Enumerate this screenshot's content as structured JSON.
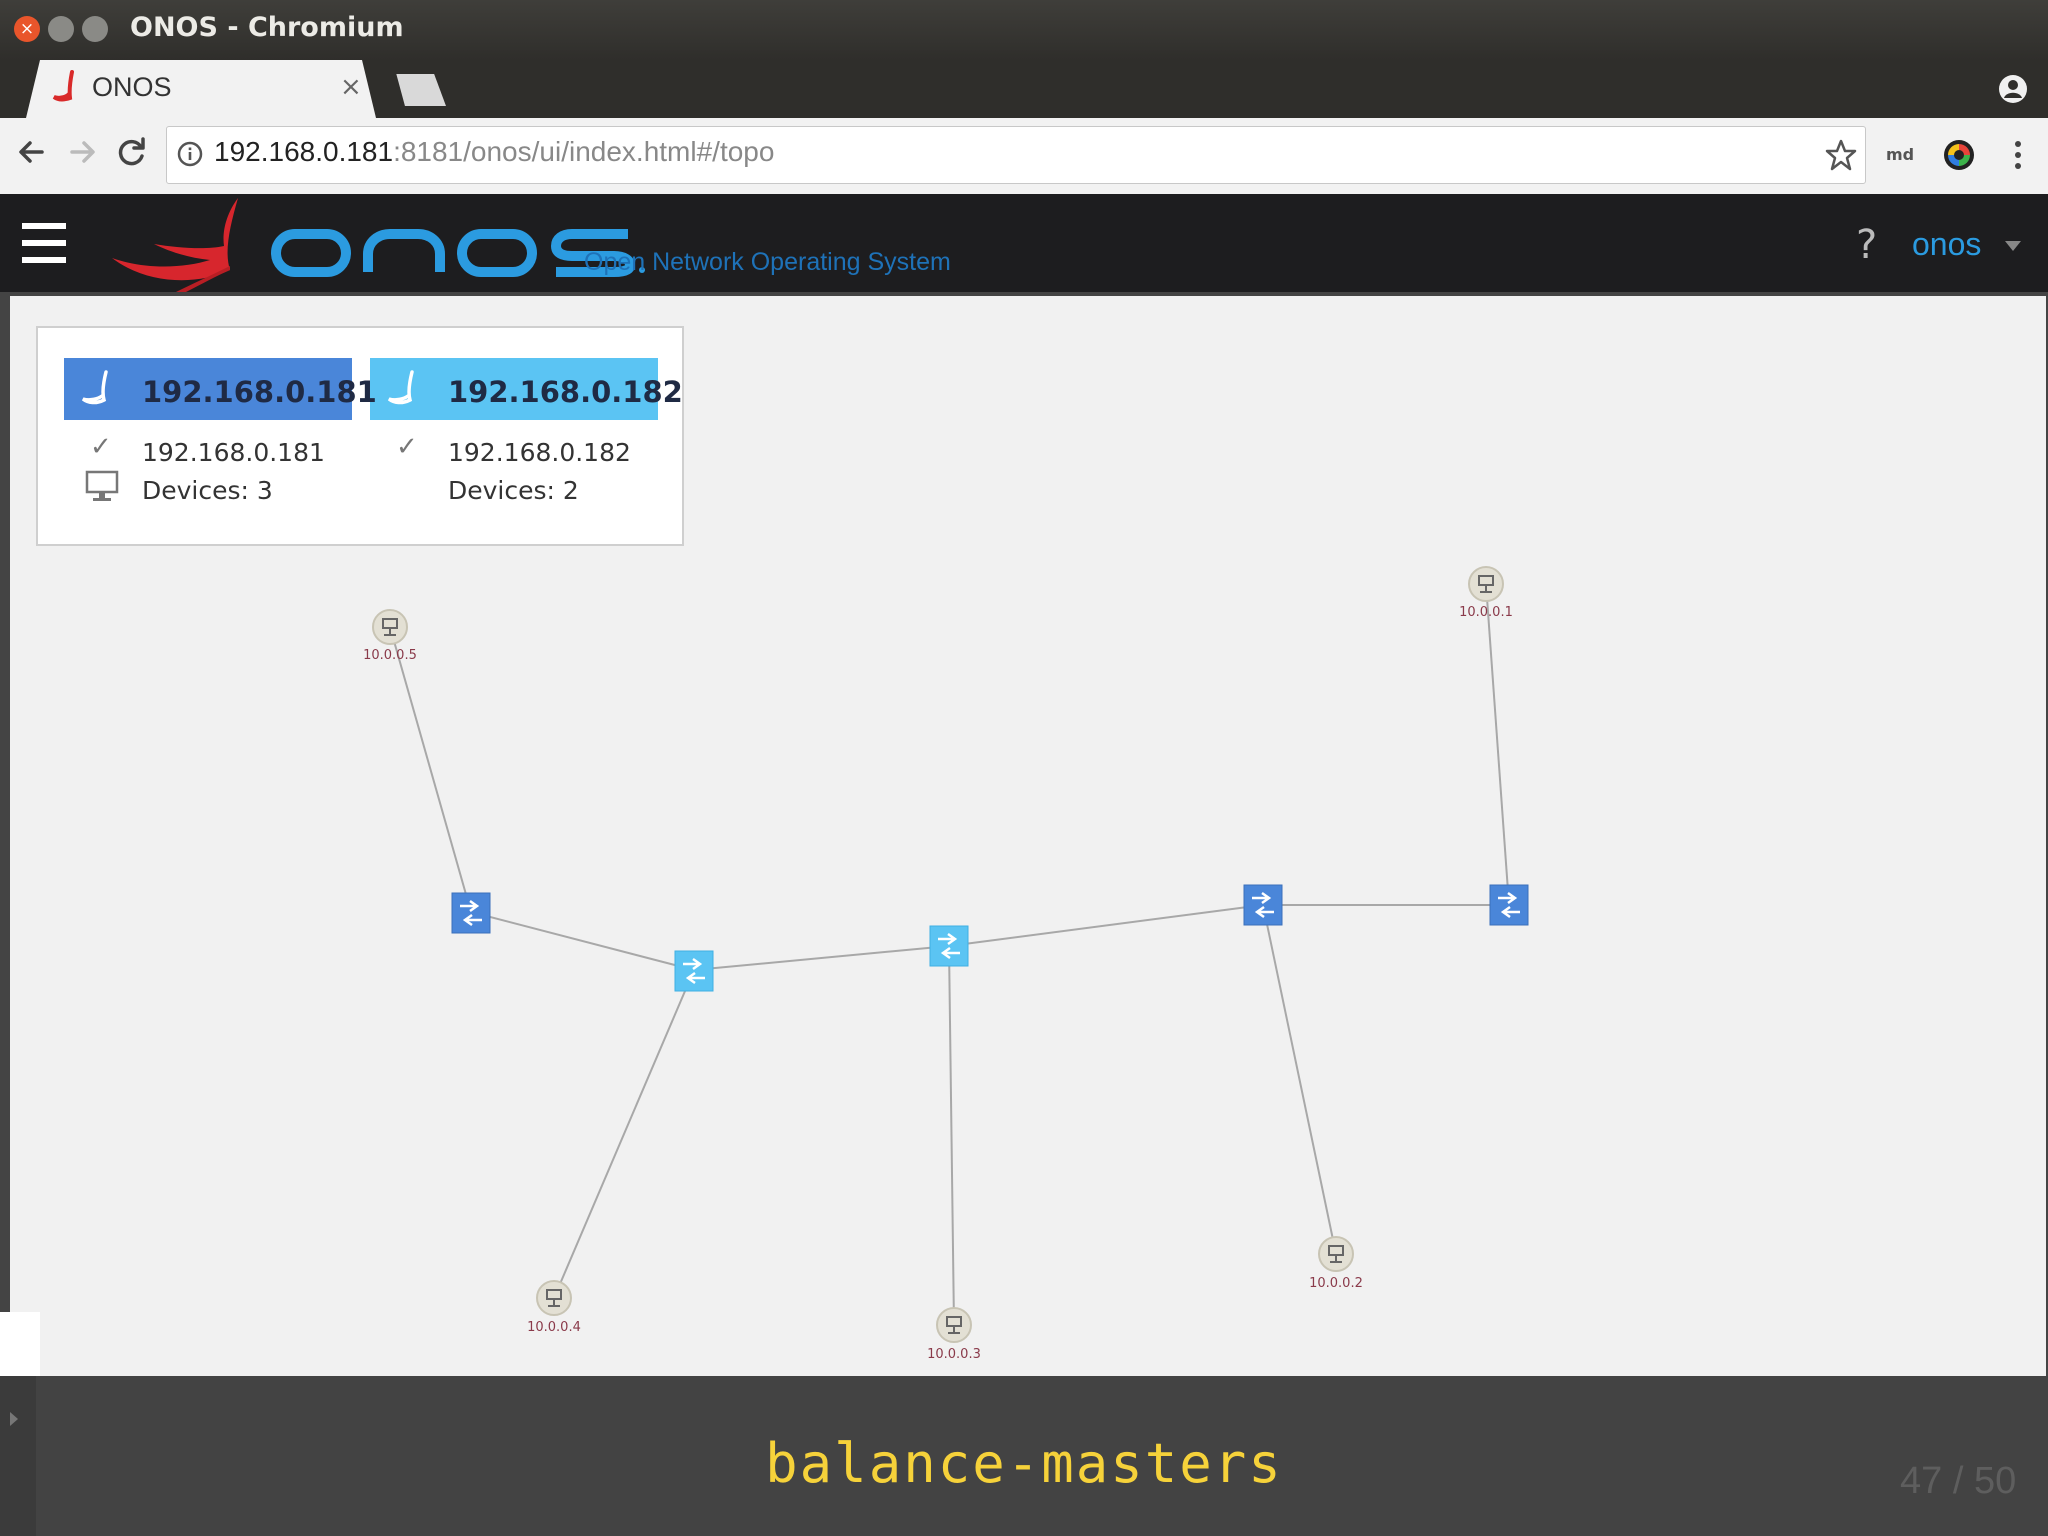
{
  "window": {
    "title": "ONOS - Chromium"
  },
  "tab": {
    "label": "ONOS",
    "close": "×"
  },
  "address_bar": {
    "host": "192.168.0.181",
    "rest": ":8181/onos/ui/index.html#/topo"
  },
  "extensions": {
    "md_label": "md"
  },
  "onos_header": {
    "tagline": "Open Network Operating System",
    "help": "?",
    "user": "onos"
  },
  "instances": [
    {
      "title": "192.168.0.181",
      "ip": "192.168.0.181",
      "devices": "Devices: 3",
      "color": "#4a86d9"
    },
    {
      "title": "192.168.0.182",
      "ip": "192.168.0.182",
      "devices": "Devices: 2",
      "color": "#5bc4f3"
    }
  ],
  "topology": {
    "hosts": [
      "10.0.0.5",
      "10.0.0.1",
      "10.0.0.4",
      "10.0.0.3",
      "10.0.0.2"
    ],
    "switch_colors": {
      "instance_181": "#4a86d9",
      "instance_182": "#5bc4f3"
    }
  },
  "slide": {
    "caption": "balance-masters",
    "page": "47 / 50"
  }
}
